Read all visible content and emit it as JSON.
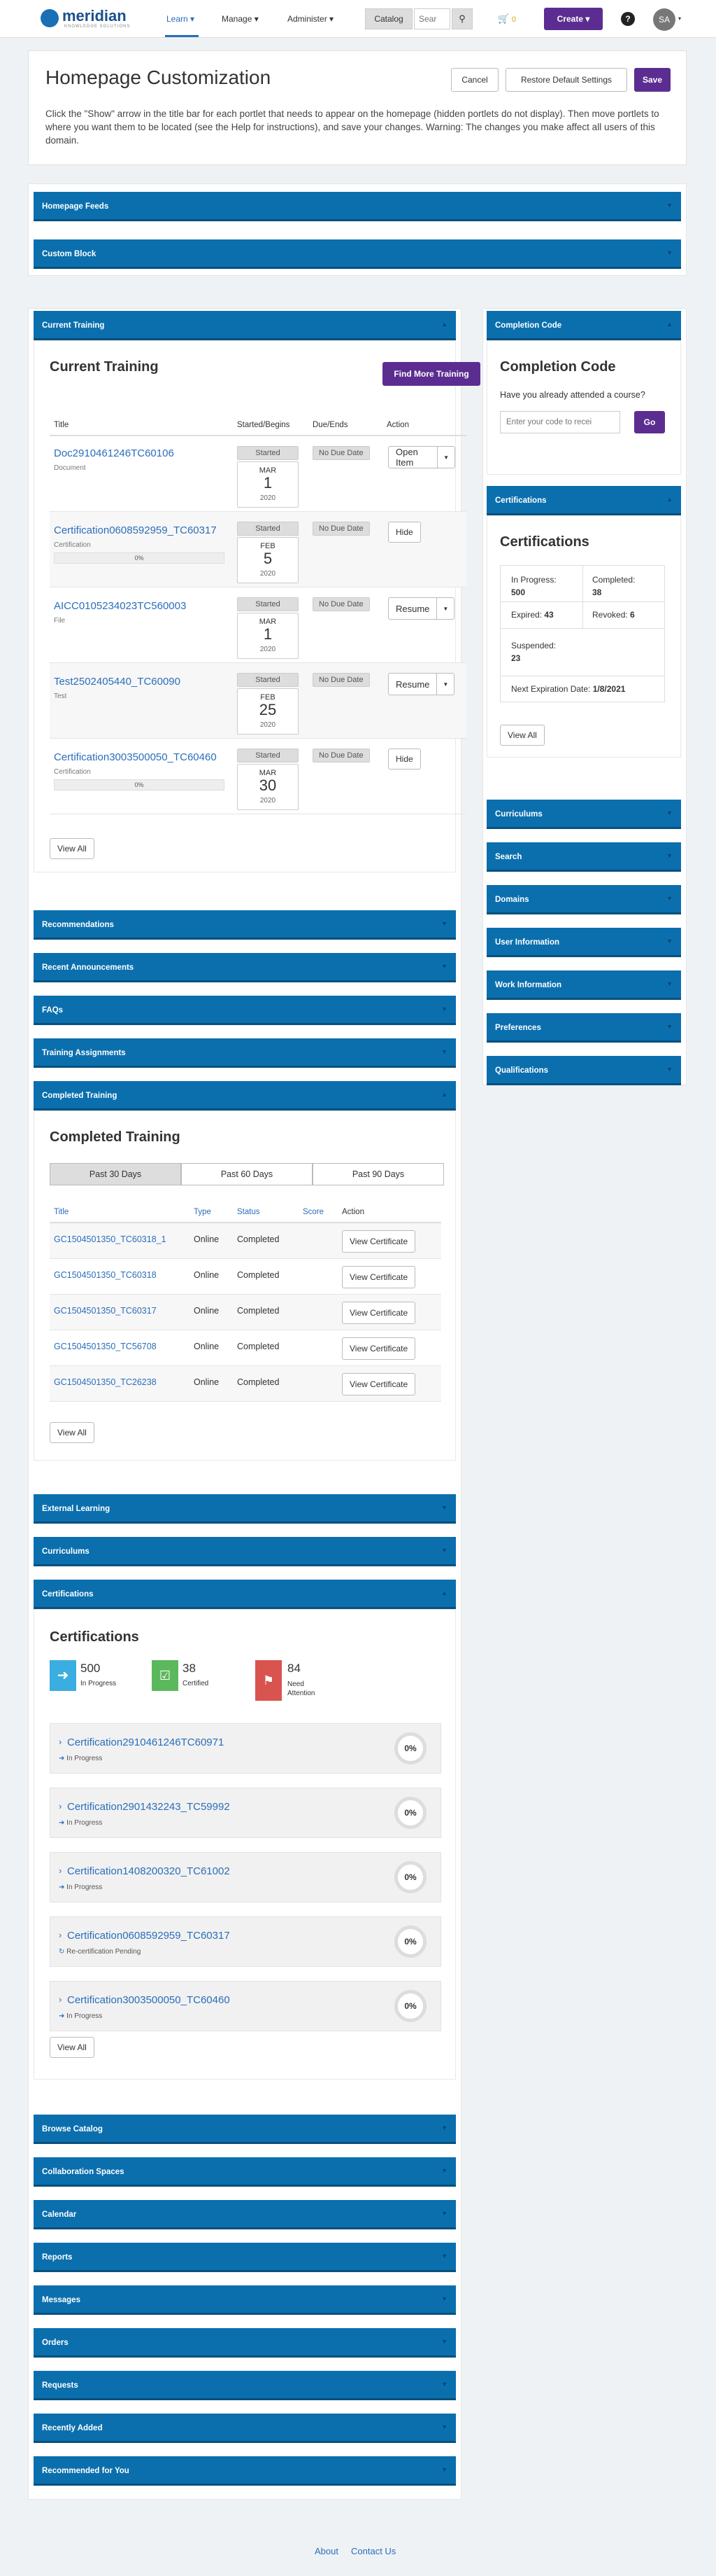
{
  "nav": {
    "brand": "meridian",
    "brand_sub": "KNOWLEDGE SOLUTIONS",
    "learn": "Learn",
    "manage": "Manage",
    "administer": "Administer",
    "catalog": "Catalog",
    "search_placeholder": "Sear",
    "cart_count": "0",
    "create": "Create",
    "avatar": "SA"
  },
  "header": {
    "title": "Homepage Customization",
    "cancel": "Cancel",
    "restore": "Restore Default Settings",
    "save": "Save",
    "instructions": "Click the \"Show\" arrow in the title bar for each portlet that needs to appear on the homepage (hidden portlets do not display). Then move portlets to where you want them to be located (see the Help for instructions), and save your changes. Warning: The changes you make affect all users of this domain."
  },
  "bars_top": [
    "Homepage Feeds",
    "Custom Block"
  ],
  "current_training": {
    "bar": "Current Training",
    "title": "Current Training",
    "find_more": "Find More Training",
    "headers": [
      "Title",
      "Started/Begins",
      "Due/Ends",
      "Action"
    ],
    "rows": [
      {
        "title": "Doc2910461246TC60106",
        "type": "Document",
        "status": "Started",
        "month": "MAR",
        "day": "1",
        "year": "2020",
        "due": "No Due Date",
        "action": "Open Item"
      },
      {
        "title": "Certification0608592959_TC60317",
        "type": "Certification",
        "status": "Started",
        "month": "FEB",
        "day": "5",
        "year": "2020",
        "due": "No Due Date",
        "action": "Hide",
        "progress": "0%"
      },
      {
        "title": "AICC0105234023TC560003",
        "type": "File",
        "status": "Started",
        "month": "MAR",
        "day": "1",
        "year": "2020",
        "due": "No Due Date",
        "action": "Resume"
      },
      {
        "title": "Test2502405440_TC60090",
        "type": "Test",
        "status": "Started",
        "month": "FEB",
        "day": "25",
        "year": "2020",
        "due": "No Due Date",
        "action": "Resume"
      },
      {
        "title": "Certification3003500050_TC60460",
        "type": "Certification",
        "status": "Started",
        "month": "MAR",
        "day": "30",
        "year": "2020",
        "due": "No Due Date",
        "action": "Hide",
        "progress": "0%"
      }
    ],
    "view_all": "View All"
  },
  "completion": {
    "bar": "Completion Code",
    "title": "Completion Code",
    "question": "Have you already attended a course?",
    "placeholder": "Enter your code to recei",
    "go": "Go"
  },
  "cert_side": {
    "bar": "Certifications",
    "title": "Certifications",
    "in_progress_label": "In Progress:",
    "in_progress": "500",
    "completed_label": "Completed:",
    "completed": "38",
    "expired_label": "Expired:",
    "expired": "43",
    "revoked_label": "Revoked:",
    "revoked": "6",
    "suspended_label": "Suspended:",
    "suspended": "23",
    "next_label": "Next Expiration Date:",
    "next": "1/8/2021",
    "view_all": "View All"
  },
  "right_bars": [
    "Curriculums",
    "Search",
    "Domains",
    "User Information",
    "Work Information",
    "Preferences",
    "Qualifications"
  ],
  "left_bars_1": [
    "Recommendations",
    "Recent Announcements",
    "FAQs",
    "Training Assignments"
  ],
  "completed": {
    "bar": "Completed Training",
    "title": "Completed Training",
    "tabs": [
      "Past 30 Days",
      "Past 60 Days",
      "Past 90 Days"
    ],
    "headers": [
      "Title",
      "Type",
      "Status",
      "Score",
      "Action"
    ],
    "rows": [
      {
        "title": "GC1504501350_TC60318_1",
        "type": "Online",
        "status": "Completed",
        "action": "View Certificate"
      },
      {
        "title": "GC1504501350_TC60318",
        "type": "Online",
        "status": "Completed",
        "action": "View Certificate"
      },
      {
        "title": "GC1504501350_TC60317",
        "type": "Online",
        "status": "Completed",
        "action": "View Certificate"
      },
      {
        "title": "GC1504501350_TC56708",
        "type": "Online",
        "status": "Completed",
        "action": "View Certificate"
      },
      {
        "title": "GC1504501350_TC26238",
        "type": "Online",
        "status": "Completed",
        "action": "View Certificate"
      }
    ],
    "view_all": "View All"
  },
  "left_bars_2": [
    "External Learning",
    "Curriculums"
  ],
  "cert_main": {
    "bar": "Certifications",
    "title": "Certifications",
    "stats": [
      {
        "num": "500",
        "label": "In Progress",
        "color": "#3aaee0"
      },
      {
        "num": "38",
        "label": "Certified",
        "color": "#5cb85c"
      },
      {
        "num": "84",
        "label": "Need Attention",
        "color": "#d9534f"
      }
    ],
    "items": [
      {
        "name": "Certification2910461246TC60971",
        "status": "In Progress",
        "pct": "0%"
      },
      {
        "name": "Certification2901432243_TC59992",
        "status": "In Progress",
        "pct": "0%"
      },
      {
        "name": "Certification1408200320_TC61002",
        "status": "In Progress",
        "pct": "0%"
      },
      {
        "name": "Certification0608592959_TC60317",
        "status": "Re-certification Pending",
        "pct": "0%"
      },
      {
        "name": "Certification3003500050_TC60460",
        "status": "In Progress",
        "pct": "0%"
      }
    ],
    "view_all": "View All"
  },
  "left_bars_3": [
    "Browse Catalog",
    "Collaboration Spaces",
    "Calendar",
    "Reports",
    "Messages",
    "Orders",
    "Requests",
    "Recently Added",
    "Recommended for You"
  ],
  "footer": {
    "about": "About",
    "contact": "Contact Us"
  }
}
